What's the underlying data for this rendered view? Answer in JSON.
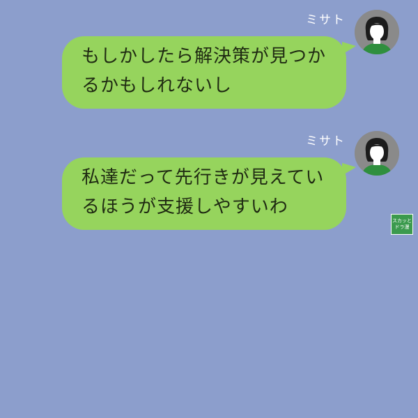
{
  "messages": [
    {
      "sender": "ミサト",
      "lines": [
        "もしかしたら解決策が見つか",
        "るかもしれないし"
      ],
      "avatar_icon": "woman-avatar-icon"
    },
    {
      "sender": "ミサト",
      "lines": [
        "私達だって先行きが見えてい",
        "るほうが支援しやすいわ"
      ],
      "avatar_icon": "woman-avatar-icon"
    }
  ],
  "badge": {
    "line1": "スカッと",
    "line2": "ドラ漫"
  },
  "colors": {
    "background": "#8c9ecc",
    "bubble": "#96d45d",
    "badge": "#3b9a4d"
  }
}
